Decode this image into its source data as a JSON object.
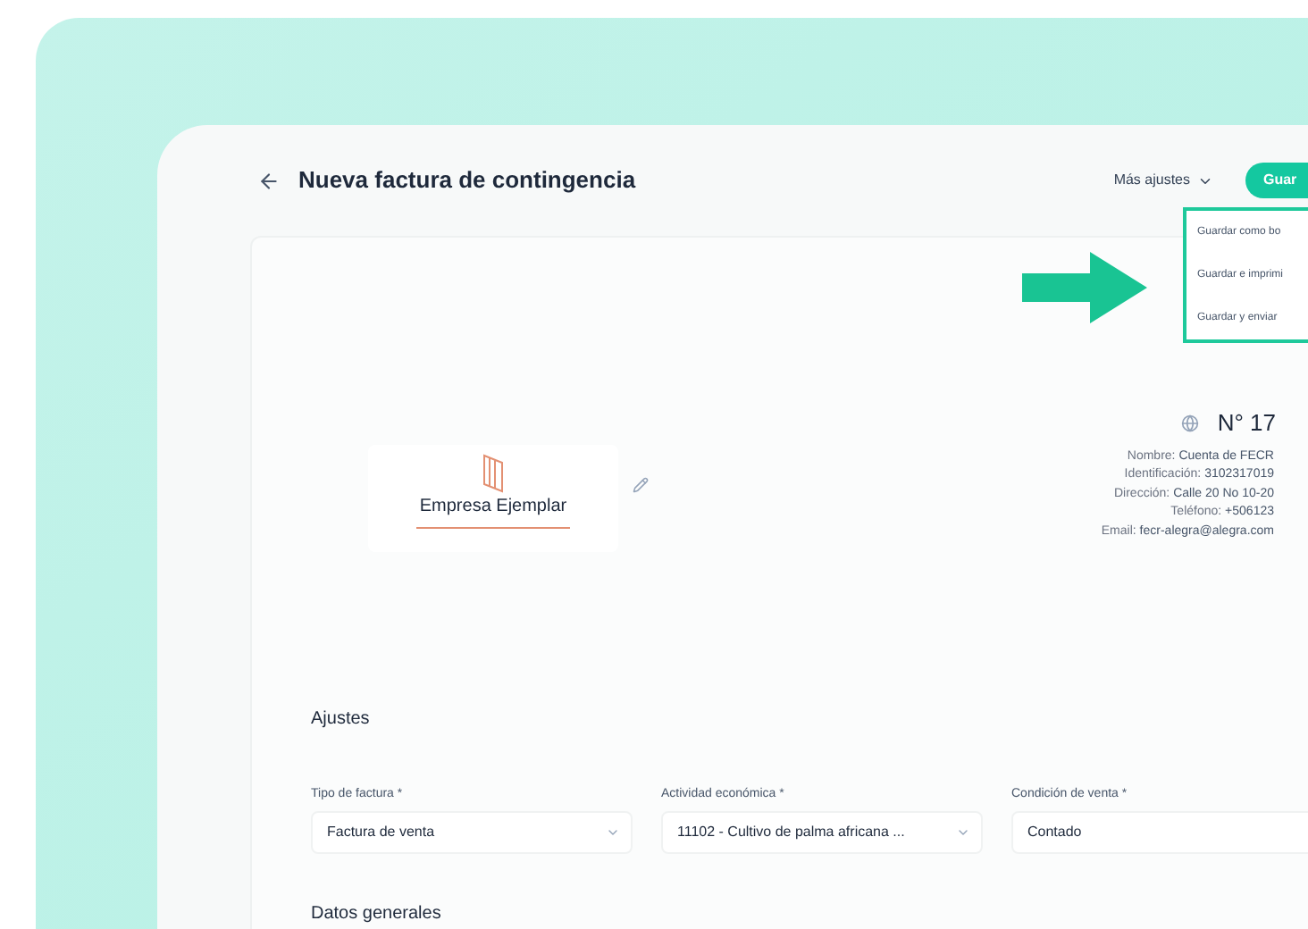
{
  "header": {
    "title": "Nueva factura de contingencia",
    "more_settings": "Más ajustes",
    "save_button": "Guar"
  },
  "save_menu": {
    "items": [
      "Guardar como bo",
      "Guardar e imprimi",
      "Guardar y enviar"
    ]
  },
  "invoice": {
    "number": "N° 17",
    "company_logo": "Empresa Ejemplar",
    "details": [
      {
        "label": "Nombre:",
        "value": "Cuenta de FECR"
      },
      {
        "label": "Identificación:",
        "value": "3102317019"
      },
      {
        "label": "Dirección:",
        "value": "Calle 20 No 10-20"
      },
      {
        "label": "Teléfono:",
        "value": "+506123"
      },
      {
        "label": "Email:",
        "value": "fecr-alegra@alegra.com"
      }
    ]
  },
  "settings": {
    "title": "Ajustes",
    "fields": [
      {
        "label": "Tipo de factura *",
        "value": "Factura de venta"
      },
      {
        "label": "Actividad económica *",
        "value": "11102 - Cultivo de palma africana ..."
      },
      {
        "label": "Condición de venta *",
        "value": "Contado"
      }
    ]
  },
  "general_data": {
    "title": "Datos generales"
  }
}
